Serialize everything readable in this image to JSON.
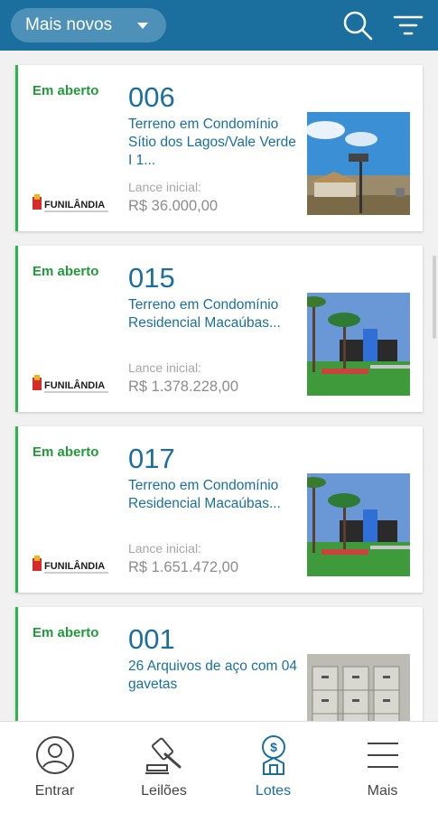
{
  "toolbar": {
    "sort_label": "Mais novos",
    "search_icon": "search-icon",
    "filter_icon": "filter-icon"
  },
  "lots": [
    {
      "status": "Em aberto",
      "number": "006",
      "title": "Terreno em Condomínio Sítio dos Lagos/Vale Verde I 1...",
      "lance_label": "Lance inicial:",
      "lance_value": "R$ 36.000,00",
      "logo_text": "FUNILÂNDIA",
      "image": "house-landscape"
    },
    {
      "status": "Em aberto",
      "number": "015",
      "title": "Terreno em Condomínio Residencial Macaúbas...",
      "lance_label": "Lance inicial:",
      "lance_value": "R$ 1.378.228,00",
      "logo_text": "FUNILÂNDIA",
      "image": "condominium-gate"
    },
    {
      "status": "Em aberto",
      "number": "017",
      "title": "Terreno em Condomínio Residencial Macaúbas...",
      "lance_label": "Lance inicial:",
      "lance_value": "R$ 1.651.472,00",
      "logo_text": "FUNILÂNDIA",
      "image": "condominium-gate"
    },
    {
      "status": "Em aberto",
      "number": "001",
      "title": "26 Arquivos de aço com 04 gavetas",
      "image": "filing-cabinets"
    }
  ],
  "nav": {
    "items": [
      {
        "label": "Entrar",
        "icon": "user-icon"
      },
      {
        "label": "Leilões",
        "icon": "gavel-icon"
      },
      {
        "label": "Lotes",
        "icon": "lots-icon"
      },
      {
        "label": "Mais",
        "icon": "menu-icon"
      }
    ],
    "active_index": 2
  },
  "colors": {
    "topbar": "#1a6f9e",
    "status_green": "#1f9b3a",
    "accent_border": "#2cb34a",
    "link_blue": "#1a6f9e"
  }
}
